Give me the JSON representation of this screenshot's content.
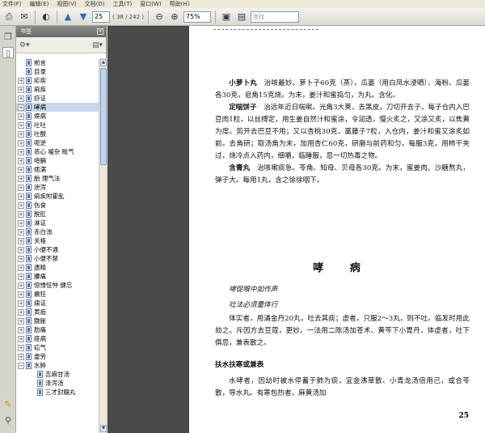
{
  "menu": [
    "文件(F)",
    "编辑(E)",
    "视图(V)",
    "文档(D)",
    "工具(T)",
    "窗口(W)",
    "帮助(H)"
  ],
  "toolbar": {
    "page_current": "25",
    "page_total": "( 38 / 242 )",
    "zoom": "75%",
    "search_placeholder": "查找"
  },
  "bookmarks_panel": {
    "title": "书签",
    "items": [
      {
        "label": "前言",
        "expandable": false,
        "child": false
      },
      {
        "label": "目录",
        "expandable": false,
        "child": false
      },
      {
        "label": "疟疾",
        "expandable": true,
        "child": false
      },
      {
        "label": "痢疾",
        "expandable": true,
        "child": false
      },
      {
        "label": "痧证",
        "expandable": true,
        "child": false
      },
      {
        "label": "哮病",
        "expandable": true,
        "child": false,
        "selected": true
      },
      {
        "label": "痨病",
        "expandable": true,
        "child": false
      },
      {
        "label": "吐吐",
        "expandable": true,
        "child": false
      },
      {
        "label": "吐酸",
        "expandable": true,
        "child": false
      },
      {
        "label": "呃逆",
        "expandable": true,
        "child": false
      },
      {
        "label": "恶心 嗳杂 眩气",
        "expandable": true,
        "child": false
      },
      {
        "label": "噎膈",
        "expandable": true,
        "child": false
      },
      {
        "label": "痞满",
        "expandable": true,
        "child": false
      },
      {
        "label": "胎 理气法",
        "expandable": true,
        "child": false
      },
      {
        "label": "泄泻",
        "expandable": true,
        "child": false
      },
      {
        "label": "痢疾附霍乱",
        "expandable": true,
        "child": false
      },
      {
        "label": "伤食",
        "expandable": true,
        "child": false
      },
      {
        "label": "脱肛",
        "expandable": true,
        "child": false
      },
      {
        "label": "淋证",
        "expandable": true,
        "child": false
      },
      {
        "label": "赤白浊",
        "expandable": true,
        "child": false
      },
      {
        "label": "关格",
        "expandable": true,
        "child": false
      },
      {
        "label": "小便不通",
        "expandable": true,
        "child": false
      },
      {
        "label": "小便不禁",
        "expandable": true,
        "child": false
      },
      {
        "label": "遗精",
        "expandable": true,
        "child": false
      },
      {
        "label": "腰痛",
        "expandable": true,
        "child": false
      },
      {
        "label": "惊悸怔忡 健忘",
        "expandable": true,
        "child": false
      },
      {
        "label": "癫狂",
        "expandable": true,
        "child": false
      },
      {
        "label": "痫证",
        "expandable": true,
        "child": false
      },
      {
        "label": "黄疸",
        "expandable": true,
        "child": false
      },
      {
        "label": "臌胀",
        "expandable": true,
        "child": false
      },
      {
        "label": "肋痛",
        "expandable": true,
        "child": false
      },
      {
        "label": "痉病",
        "expandable": true,
        "child": false
      },
      {
        "label": "疝气",
        "expandable": true,
        "child": false
      },
      {
        "label": "虚劳",
        "expandable": true,
        "child": false
      },
      {
        "label": "水肿",
        "expandable": true,
        "child": false,
        "expanded": true
      },
      {
        "label": "吉麻甘汤",
        "expandable": false,
        "child": true
      },
      {
        "label": "泽泻汤",
        "expandable": false,
        "child": true
      },
      {
        "label": "三才封髓丸",
        "expandable": false,
        "child": true
      }
    ]
  },
  "document": {
    "lines": [
      {
        "type": "p",
        "lead": "小萝卜丸",
        "text": "治咳最妙。萝卜子60克（蒸），瓜蒌（用白凤水浸晒）、海粉、瓜蒌各30克，皂角15克烧。为末，姜汁和蜜捣匀，为丸。含化。"
      },
      {
        "type": "p",
        "lead": "定喘饼子",
        "text": "治远年近日喘嗽。光角3大荚，去黑皮，刀切开去子，每子仓内入巴豆肉1粒，以丝缚定，用生姜自然汁和蜜涂，令润透，慢火炙之，又涂又炙，以焦黄为度。剪开去巴豆不用；又以杏桃30克，藁藤子7粒，入仓内，姜汁和蜜又涂炙如前。去角研；取汤角为末，加用杏仁60克，研磨与前药和匀，每服3克，用柿干夹过，烧冷点入药内，细嚼，临睡服，忌一切热毒之物。"
      },
      {
        "type": "p",
        "lead": "含膏丸",
        "text": "治咳嗽痰急。苓角、知母、贝母各30克。为末，蜜姜肉、沙糖熬丸，弹子大。每用1丸，含之徐徐咽下。"
      }
    ],
    "section_title": "哮 病",
    "hand_lines": [
      "哮促喉中如作声",
      "吐法必须量体行"
    ],
    "lines2": [
      {
        "type": "p",
        "lead": "",
        "text": "体实者，用涌金丹20丸，吐去其痰；虚者，只服2～3丸，则不吐。临发时用此劫之。斥因方去豆蔻，更妙。一法用二陈汤加苍术、黄芩下小胃丹，体虚者，吐下俱忌，兼表散之。"
      }
    ],
    "subheading": "扶水扶寒或兼表",
    "lines3": [
      {
        "type": "p",
        "lead": "",
        "text": "水哮者，因幼时被水停蓄于肺为痰，宜金沸草散、小青龙汤倍用己，或合苓散，导水丸。有寒包热者，麻黄汤加"
      }
    ],
    "page_number": "25"
  }
}
